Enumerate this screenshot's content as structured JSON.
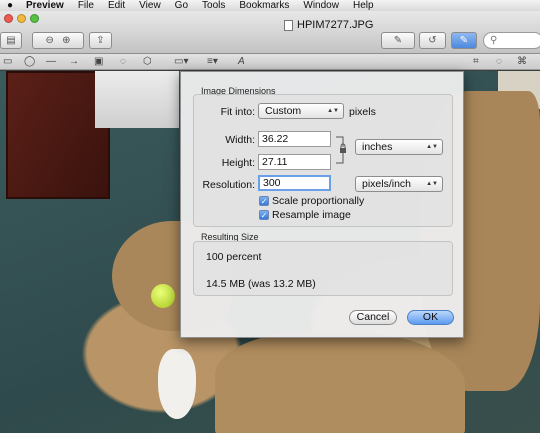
{
  "menubar": {
    "apple": "",
    "items": [
      "Preview",
      "File",
      "Edit",
      "View",
      "Go",
      "Tools",
      "Bookmarks",
      "Window",
      "Help"
    ]
  },
  "window": {
    "title": "HPIM7277.JPG"
  },
  "toolbar": {
    "search_placeholder": ""
  },
  "dialog": {
    "image_dimensions_label": "Image Dimensions",
    "fit_into_label": "Fit into:",
    "fit_into_value": "Custom",
    "fit_into_unit": "pixels",
    "width_label": "Width:",
    "width_value": "36.22",
    "height_label": "Height:",
    "height_value": "27.11",
    "size_unit": "inches",
    "resolution_label": "Resolution:",
    "resolution_value": "300",
    "resolution_unit": "pixels/inch",
    "scale_label": "Scale proportionally",
    "scale_checked": true,
    "resample_label": "Resample image",
    "resample_checked": true,
    "resulting_size_label": "Resulting Size",
    "percent_text": "100 percent",
    "size_text": "14.5 MB (was 13.2 MB)",
    "cancel_label": "Cancel",
    "ok_label": "OK"
  },
  "colors": {
    "accent": "#5c9bf0",
    "close": "#ee5a52",
    "minimize": "#f1b93b",
    "zoom": "#56c142"
  }
}
